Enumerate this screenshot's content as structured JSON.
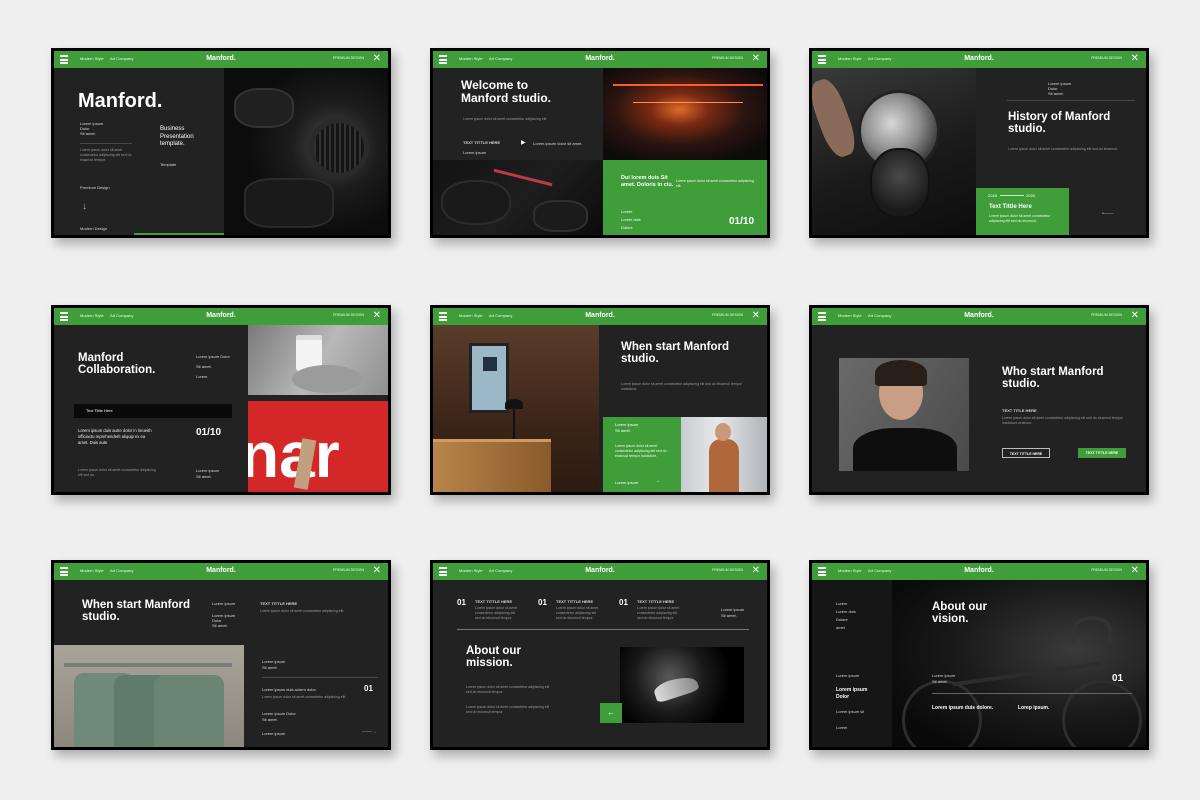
{
  "header": {
    "left1": "Modern Style",
    "left2": "Art Company",
    "brand": "Manford.",
    "right": "PREMIUM DESIGN",
    "close": "✕"
  },
  "s1": {
    "title": "Manford.",
    "lorem1": "Lorem ipsum",
    "lorem2": "Dolor",
    "lorem3": "Sit amet.",
    "subtitle": "Business Presentation template.",
    "template": "Template",
    "premium": "Premium Design",
    "modern": "Modern Design",
    "para": "Lorem ipsum dolor sit amet consectetur adipiscing elit sed do eiusmod tempor."
  },
  "s2": {
    "title": "Welcome to Manford studio.",
    "ttext": "TEXT TITTLE HERE",
    "lorem": "Lorem ipsum",
    "arrow_text": "Lorem ipsum dolor sit amet.",
    "green_title": "Dui lorem duis Sit amet. Doloris in ciu.",
    "l1": "Lorem",
    "l2": "Lorem duis",
    "l3": "Dolore",
    "num": "01/10",
    "para": "Lorem ipsum dolor sit amet consectetur adipiscing elit."
  },
  "s3": {
    "title": "History of Manford studio.",
    "y1": "2018",
    "y2": "2020",
    "green_title": "Text Tittle Here",
    "l1": "Lorem ipsum",
    "l2": "Dolor",
    "l3": "Sit amet.",
    "para": "Lorem ipsum dolor sit amet consectetur adipiscing elit sed do eiusmod."
  },
  "s4": {
    "title": "Manford Collaboration.",
    "l1": "Lorem ipsum Dolor",
    "l2": "Sit amet.",
    "l3": "Lorem",
    "bar": "Text Tittle Here",
    "body": "Lorem ipsum duis autre dolor in lorueith officiactu reprehenderit aliquip ex ea amet. Duis aute",
    "num": "01/10",
    "l4": "Lorem ipsum",
    "l5": "Sit amet.",
    "para": "Lorem ipsum dolor sit amet consectetur adipiscing elit sed do."
  },
  "s5": {
    "title": "When start Manford studio.",
    "g1": "Lorem ipsum",
    "g2": "Sit amet.",
    "g3": "Lorem ipsum",
    "para": "Lorem ipsum dolor sit amet consectetur adipiscing elit sed do eiusmod tempor incididunt."
  },
  "s6": {
    "title": "Who start Manford studio.",
    "ttext": "TEXT TITLE HERE",
    "b1": "TEXT TITTLE HERE",
    "b2": "TEXT TITTLE HERE",
    "para": "Lorem ipsum dolor sit amet consectetur adipiscing elit sed do eiusmod tempor incididunt ut labore."
  },
  "s7": {
    "title": "When start Manford studio.",
    "l1": "Lorem ipsum",
    "l2": "Lorem ipsum",
    "l3": "Dolor",
    "l4": "Sit amet.",
    "ttext": "TEXT TITTLE HERE",
    "l5": "Lorem ipsum",
    "l6": "Sit amet.",
    "l7": "Lorem ipsum duis autem dolor.",
    "num": "01",
    "l8": "Lorem ipsum Dolor",
    "l9": "Sit amet.",
    "l10": "Lorem ipsum",
    "para": "Lorem ipsum dolor sit amet consectetur adipiscing elit."
  },
  "s8": {
    "n1": "01",
    "n2": "01",
    "n3": "01",
    "t1": "TEXT TITTLE HERE",
    "t2": "TEXT TITTLE HERE",
    "t3": "TEXT TITTLE HERE",
    "l1": "Lorem ipsum",
    "l2": "Sit amet.",
    "title": "About our mission.",
    "para": "Lorem ipsum dolor sit amet consectetur adipiscing elit sed do eiusmod tempor."
  },
  "s9": {
    "title": "About our vision.",
    "m1": "Lorem",
    "m2": "Lorem duis",
    "m3": "Dolore",
    "m4": "amet",
    "s1": "Lorem ipsum",
    "s2": "Lorem ipsum Dolor",
    "s3": "Lorem ipsum sit",
    "s4": "Lorem",
    "c1": "Lorem ipsum",
    "c2": "Sit amet.",
    "num": "01",
    "f1": "Lorem ipsum duis dolore.",
    "f2": "Lorep ipsum."
  },
  "colors": {
    "accent": "#3f9e3a",
    "slide_bg": "#222222",
    "page_bg": "#efefef"
  }
}
